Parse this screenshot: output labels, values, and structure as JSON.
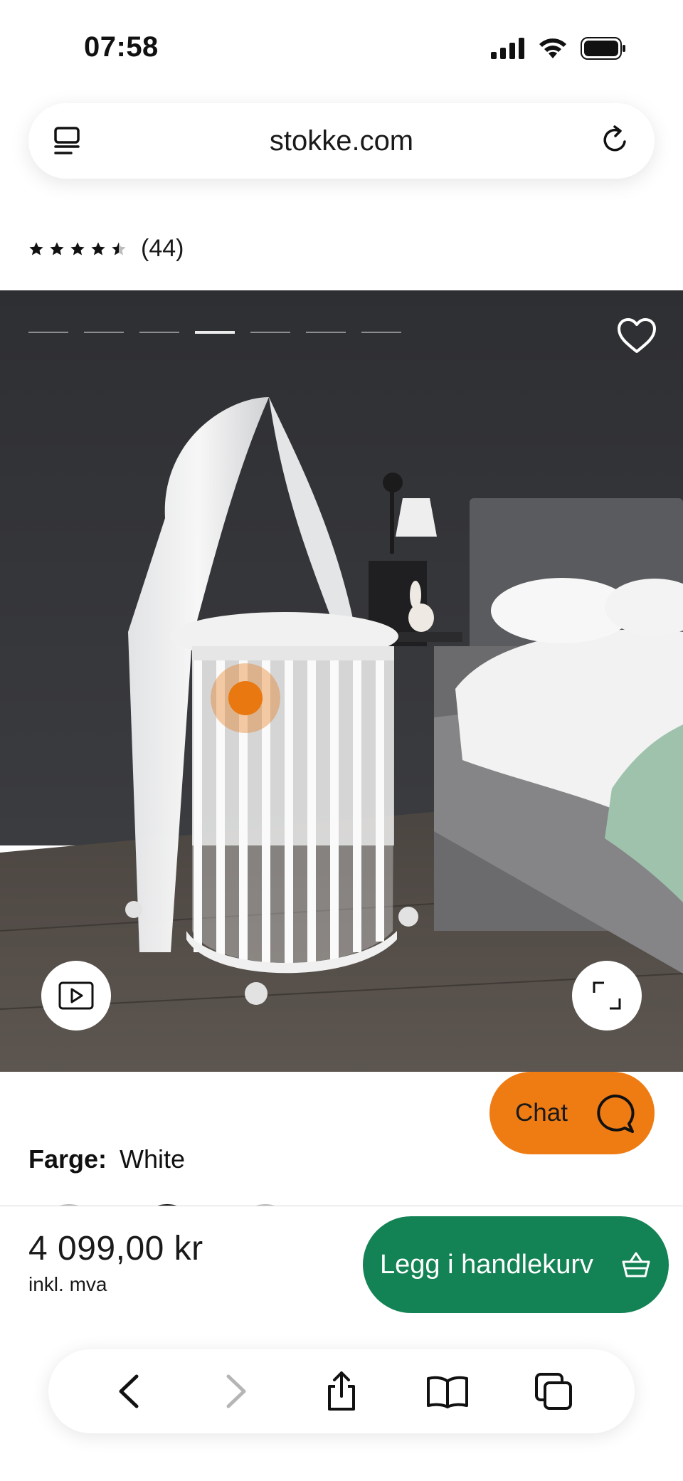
{
  "status_bar": {
    "time": "07:58"
  },
  "url_bar": {
    "domain": "stokke.com"
  },
  "rating": {
    "stars": 4.5,
    "max_stars": 5,
    "count_label": "(44)"
  },
  "gallery": {
    "image_count": 7,
    "active_index": 3
  },
  "chat": {
    "label": "Chat"
  },
  "color": {
    "label": "Farge:",
    "value": "White"
  },
  "purchase": {
    "price": "4 099,00 kr",
    "price_note": "inkl. mva",
    "cart_label": "Legg i handlekurv"
  },
  "colors": {
    "accent_orange": "#ef7b13",
    "cart_green": "#138254"
  },
  "toolbar": {
    "icons": [
      "back-icon",
      "forward-icon",
      "share-icon",
      "bookmarks-icon",
      "tabs-icon"
    ]
  }
}
